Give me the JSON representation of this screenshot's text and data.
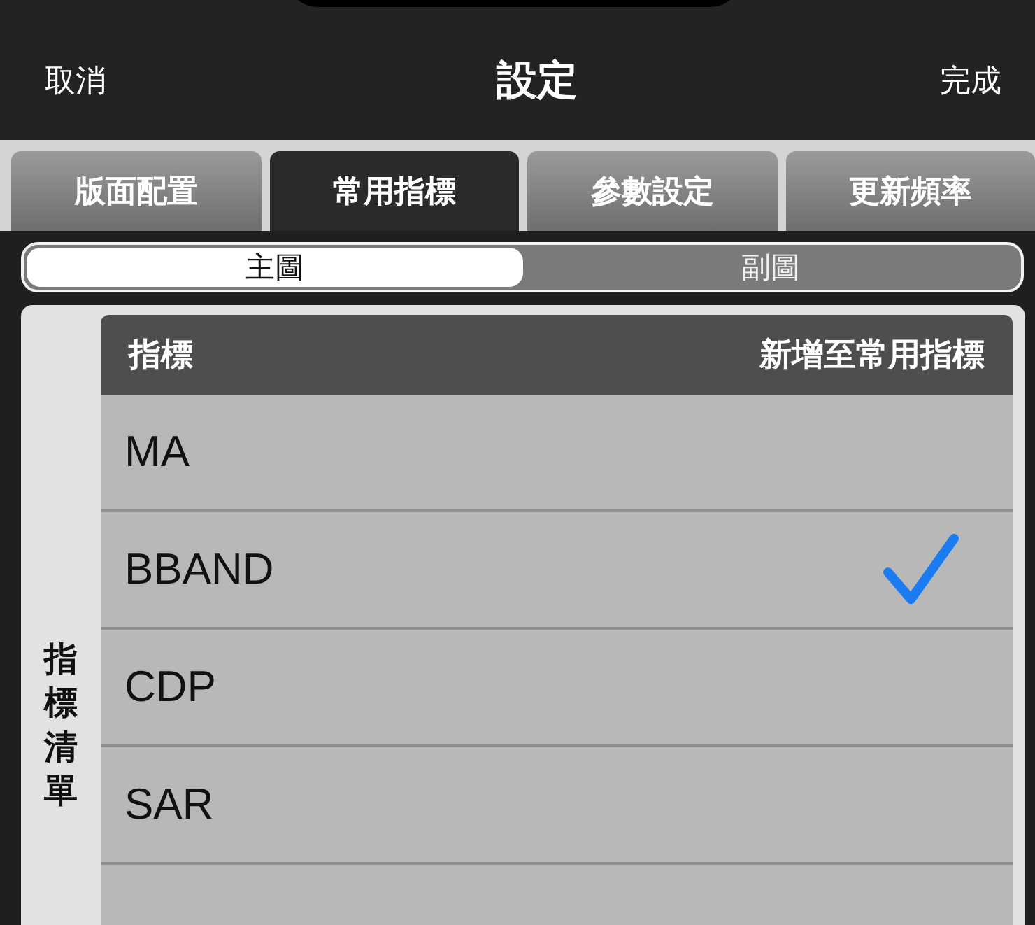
{
  "nav": {
    "cancel": "取消",
    "title": "設定",
    "done": "完成"
  },
  "tabs": [
    {
      "label": "版面配置",
      "selected": false
    },
    {
      "label": "常用指標",
      "selected": true
    },
    {
      "label": "參數設定",
      "selected": false
    },
    {
      "label": "更新頻率",
      "selected": false
    }
  ],
  "segments": [
    {
      "label": "主圖",
      "selected": true
    },
    {
      "label": "副圖",
      "selected": false
    }
  ],
  "side_label": "指標清單",
  "table": {
    "columns": [
      "指標",
      "新增至常用指標"
    ],
    "rows": [
      {
        "name": "MA",
        "checked": false
      },
      {
        "name": "BBAND",
        "checked": true
      },
      {
        "name": "CDP",
        "checked": false
      },
      {
        "name": "SAR",
        "checked": false
      }
    ]
  }
}
